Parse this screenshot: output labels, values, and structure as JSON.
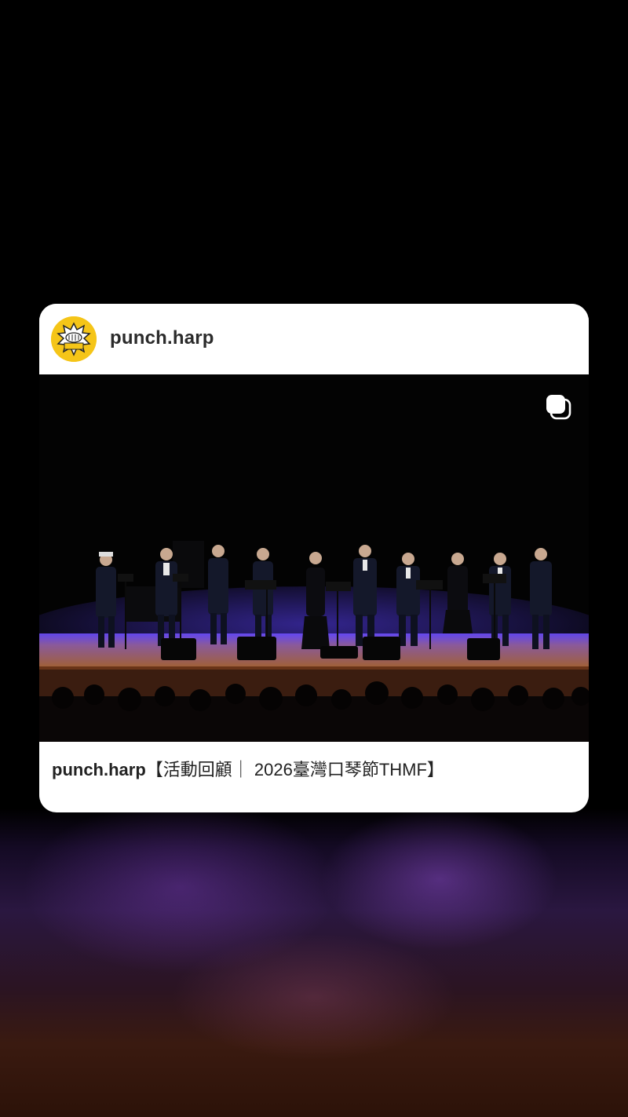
{
  "post": {
    "username": "punch.harp",
    "avatar_logo_text": "PUNCH",
    "caption_user": "punch.harp",
    "caption_text": "【活動回顧｜ 2026臺灣口琴節THMF】",
    "media_type_icon": "multiple-photos-icon"
  },
  "colors": {
    "avatar_bg": "#f5c518",
    "stage_light": "#6a4cff"
  }
}
